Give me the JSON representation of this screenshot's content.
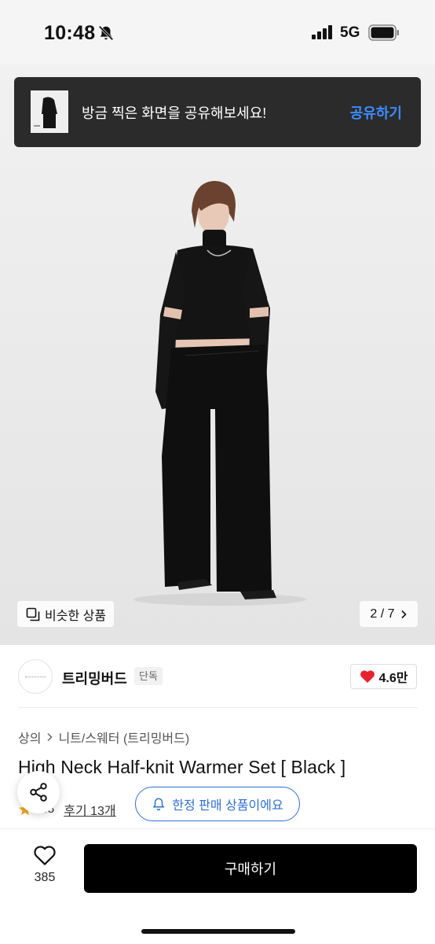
{
  "status": {
    "time": "10:48",
    "network": "5G"
  },
  "toast": {
    "message": "방금 찍은 화면을 공유해보세요!",
    "action": "공유하기"
  },
  "hero": {
    "similar_label": "비슷한 상품",
    "pager": "2 / 7"
  },
  "shop": {
    "name": "트리밍버드",
    "badge": "단독",
    "likes": "4.6만"
  },
  "product": {
    "breadcrumb": [
      "상의",
      "니트/스웨터 (트리밍버드)"
    ],
    "title": "High Neck Half-knit Warmer Set [ Black ]",
    "rating": "4.8",
    "reviews": "후기 13개",
    "limited_label": "한정 판매 상품이에요"
  },
  "bottom": {
    "wishlist_count": "385",
    "buy_label": "구매하기"
  },
  "colors": {
    "accent_blue": "#2f6fd6",
    "toast_action": "#3d8cff",
    "heart_red": "#e8232f",
    "star": "#f5a623"
  }
}
